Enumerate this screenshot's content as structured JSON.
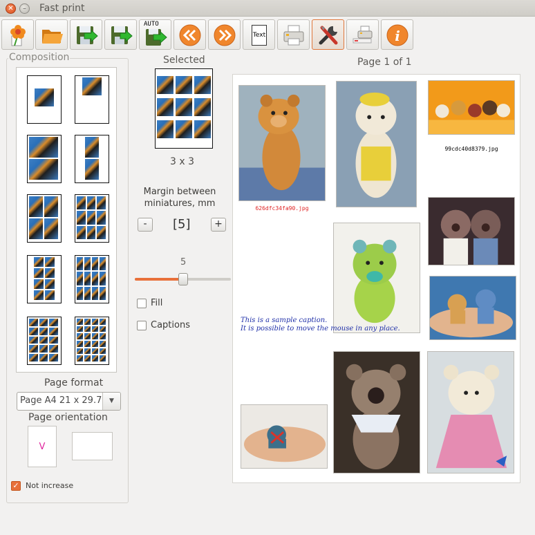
{
  "window": {
    "title": "Fast print"
  },
  "toolbar": {
    "buttons": [
      {
        "name": "flower",
        "label": ""
      },
      {
        "name": "open",
        "label": ""
      },
      {
        "name": "save-next",
        "label": ""
      },
      {
        "name": "save",
        "label": ""
      },
      {
        "name": "auto",
        "label": "AUTO"
      },
      {
        "name": "prev",
        "label": ""
      },
      {
        "name": "next",
        "label": ""
      },
      {
        "name": "text",
        "label": "Text"
      },
      {
        "name": "print",
        "label": ""
      },
      {
        "name": "settings",
        "label": ""
      },
      {
        "name": "printer-setup",
        "label": ""
      },
      {
        "name": "info",
        "label": ""
      }
    ]
  },
  "composition": {
    "label": "Composition"
  },
  "selected": {
    "label": "Selected",
    "grid": "3 x 3"
  },
  "margin": {
    "label": "Margin between miniatures, mm",
    "value": "[5]",
    "minus": "-",
    "plus": "+",
    "slider_value": "5",
    "slider_fraction": 0.5
  },
  "options": {
    "fill": "Fill",
    "captions": "Captions"
  },
  "page_format": {
    "label": "Page format",
    "value": "Page A4 21 x 29.7"
  },
  "page_orientation": {
    "label": "Page orientation",
    "portrait_mark": "V"
  },
  "not_increase": {
    "label": "Not increase",
    "checked": true
  },
  "preview": {
    "page_label": "Page 1 of 1",
    "caption1": "626dfc34fa90.jpg",
    "caption2": "99cdc40d8379.jpg",
    "sample_line1": "This is a sample caption.",
    "sample_line2": "It is possible to move the mouse in any place."
  },
  "colors": {
    "accent": "#e8703a",
    "caption_red": "#e02020",
    "sample_blue": "#1f2fa8",
    "portrait_mark": "#e0269e"
  }
}
